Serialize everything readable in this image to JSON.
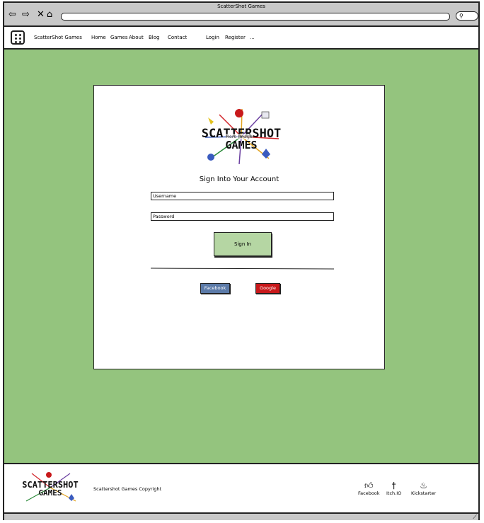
{
  "browser": {
    "window_title": "ScatterShot Games",
    "back_icon": "back-arrow-icon",
    "forward_icon": "forward-arrow-icon",
    "close_icon": "close-icon",
    "home_icon": "home-icon",
    "search_icon": "search-icon"
  },
  "nav": {
    "brand": "ScatterShot Games",
    "links": [
      "Home",
      "Games",
      "About",
      "Blog",
      "Contact"
    ],
    "login": "Login",
    "register": "Register",
    "more": "..."
  },
  "hero": {
    "logo_line1": "SCATTERSHOT",
    "logo_line2": "GAMES",
    "image_label": "Hero Image"
  },
  "signin": {
    "title": "Sign Into Your Account",
    "username_placeholder": "Username",
    "password_placeholder": "Password",
    "button": "Sign In",
    "facebook": "Facebook",
    "google": "Google"
  },
  "footer": {
    "logo_line1": "SCATTERSHOT",
    "logo_line2": "GAMES",
    "copyright": "Scattershot Games Copyright",
    "links": [
      {
        "label": "Facebook",
        "icon": "thumbs-up-icon"
      },
      {
        "label": "Itch.IO",
        "icon": "dagger-icon"
      },
      {
        "label": "Kickstarter",
        "icon": "flame-icon"
      }
    ]
  },
  "colors": {
    "main_bg": "#94c47e",
    "signin_button": "#b5d6a3",
    "facebook": "#5b7aa8",
    "google": "#c8191b"
  }
}
